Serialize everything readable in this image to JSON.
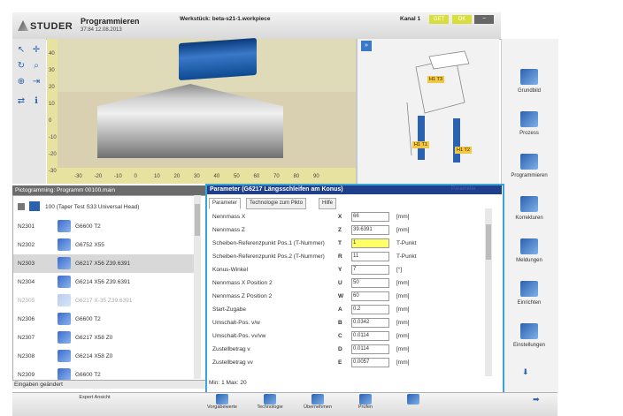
{
  "header": {
    "logo_text": "STUDER",
    "title": "Programmieren",
    "date": "37:84 12.08.2013",
    "workpiece": "Werkstück: beta-s21-1.workpiece",
    "channel": "Kanal 1",
    "get_label": "GET",
    "ok_label": "OK"
  },
  "viewport": {
    "ruler_x": [
      "-30",
      "-20",
      "-10",
      "0",
      "10",
      "20",
      "30",
      "40",
      "50",
      "60",
      "70",
      "80",
      "90"
    ],
    "ruler_y": [
      "40",
      "30",
      "20",
      "10",
      "0",
      "-10",
      "-20",
      "-30"
    ],
    "tools_side": [
      "H1 T3",
      "H1 T1",
      "H1 T2"
    ]
  },
  "sidebar": {
    "items": [
      {
        "label": "Grundbild"
      },
      {
        "label": "Prozess"
      },
      {
        "label": "Programmieren"
      },
      {
        "label": "Korrekturen"
      },
      {
        "label": "Meldungen"
      },
      {
        "label": "Einrichten"
      },
      {
        "label": "Einstellungen"
      }
    ]
  },
  "list": {
    "title": "Pictogramming: Programm 00100.main",
    "header_row": "100 (Taper Test S33 Universal Head)",
    "rows": [
      {
        "n": "N2301",
        "text": "G6600 T2"
      },
      {
        "n": "N2302",
        "text": "G6752 X55"
      },
      {
        "n": "N2303",
        "text": "G6217 X56 Z39.6391"
      },
      {
        "n": "N2304",
        "text": "G6214 X56 Z39.6391"
      },
      {
        "n": "N2305",
        "text": "G6217 X-35 Z39.6391"
      },
      {
        "n": "N2306",
        "text": "G6600 T2"
      },
      {
        "n": "N2307",
        "text": "G6217 X58 Z0"
      },
      {
        "n": "N2308",
        "text": "G6214 X58 Z0"
      },
      {
        "n": "N2309",
        "text": "G6600 T2"
      }
    ],
    "status": "Eingaben geändert"
  },
  "param": {
    "title": "Parameter (G6217 Längsschleifen am Konus)",
    "help": "Parameter",
    "tabs": [
      "Parameter",
      "Technologie zum Pikto",
      "Hilfe"
    ],
    "rows": [
      {
        "label": "Nennmass X",
        "sym": "X",
        "value": "66",
        "unit": "[mm]"
      },
      {
        "label": "Nennmass Z",
        "sym": "Z",
        "value": "39.6391",
        "unit": "[mm]"
      },
      {
        "label": "Scheiben-Referenzpunkt Pos.1 (T-Nummer)",
        "sym": "T",
        "value": "1",
        "unit": "T-Punkt"
      },
      {
        "label": "Scheiben-Referenzpunkt Pos.2 (T-Nummer)",
        "sym": "R",
        "value": "11",
        "unit": "T-Punkt"
      },
      {
        "label": "Konus-Winkel",
        "sym": "Y",
        "value": "7",
        "unit": "[°]"
      },
      {
        "label": "Nennmass X Position 2",
        "sym": "U",
        "value": "50",
        "unit": "[mm]"
      },
      {
        "label": "Nennmass Z Position 2",
        "sym": "W",
        "value": "60",
        "unit": "[mm]"
      },
      {
        "label": "Start-Zugabe",
        "sym": "A",
        "value": "0.2",
        "unit": "[mm]"
      },
      {
        "label": "Umschalt-Pos. v/w",
        "sym": "B",
        "value": "0.0342",
        "unit": "[mm]"
      },
      {
        "label": "Umschalt-Pos. vv/vw",
        "sym": "C",
        "value": "0.0114",
        "unit": "[mm]"
      },
      {
        "label": "Zustellbetrag v",
        "sym": "D",
        "value": "0.0114",
        "unit": "[mm]"
      },
      {
        "label": "Zustellbetrag vv",
        "sym": "E",
        "value": "0.0057",
        "unit": "[mm]"
      }
    ],
    "minmax": "Min: 1   Max: 20"
  },
  "bottombar": {
    "items": [
      "Expert Ansicht",
      "Vorgabewerte",
      "Technologie",
      "Übernehmen",
      "Prüfen",
      ""
    ]
  }
}
